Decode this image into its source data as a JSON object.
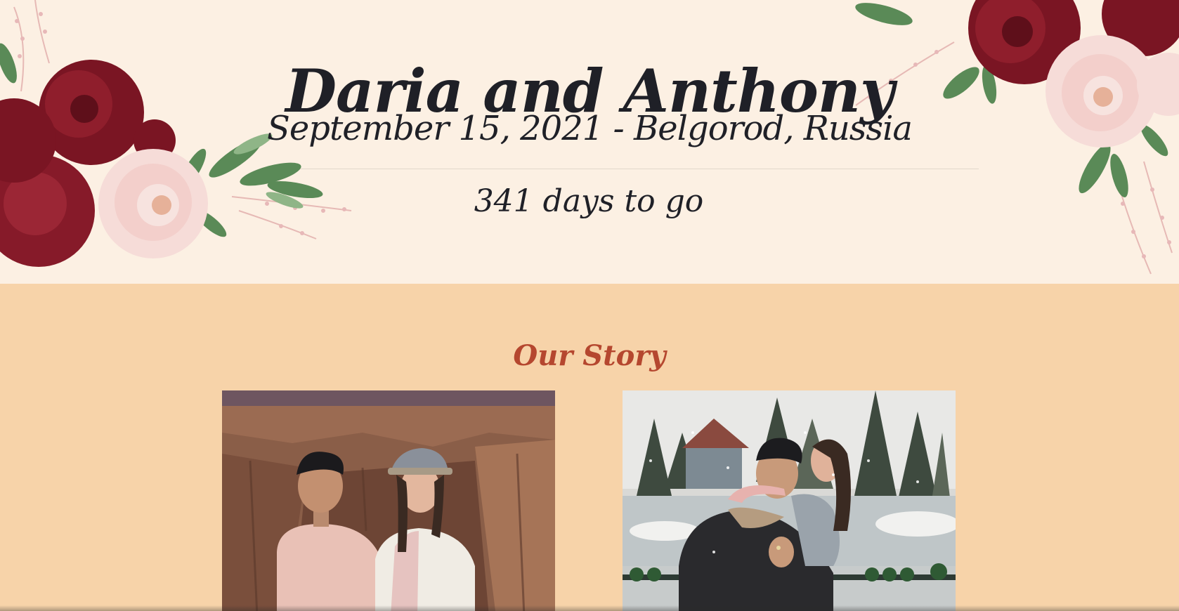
{
  "hero": {
    "title": "Daria and Anthony",
    "subtitle": "September 15, 2021 - Belgorod, Russia",
    "countdown": "341 days to go"
  },
  "story": {
    "heading": "Our Story",
    "photos": [
      {
        "id": "canyon-photo"
      },
      {
        "id": "winter-photo"
      }
    ]
  },
  "colors": {
    "hero_background": "#fcf0e3",
    "section_background": "#f7d3a9",
    "title_text": "#1f2027",
    "heading_accent": "#b5472f",
    "burgundy_flower": "#7a1523",
    "blush_flower": "#f3cfcb",
    "leaf": "#4e7f4c"
  }
}
